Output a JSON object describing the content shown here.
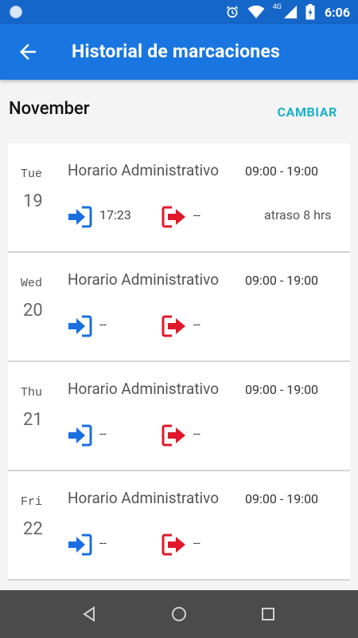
{
  "status_bar": {
    "time": "6:06",
    "network": "4G"
  },
  "app_bar": {
    "title": "Historial de marcaciones",
    "back_icon": "arrow-back-icon"
  },
  "month": {
    "title": "November",
    "change_label": "CAMBIAR"
  },
  "colors": {
    "primary": "#1976e0",
    "status": "#1566c9",
    "accent": "#1ab1c9",
    "in": "#1a6fe0",
    "out": "#e0182a"
  },
  "days": [
    {
      "day_name": "Tue",
      "day_num": "19",
      "schedule": "Horario Administrativo",
      "hours": "09:00 - 19:00",
      "in_time": "17:23",
      "out_time": "--",
      "note": "atraso 8 hrs"
    },
    {
      "day_name": "Wed",
      "day_num": "20",
      "schedule": "Horario Administrativo",
      "hours": "09:00 - 19:00",
      "in_time": "--",
      "out_time": "--",
      "note": ""
    },
    {
      "day_name": "Thu",
      "day_num": "21",
      "schedule": "Horario Administrativo",
      "hours": "09:00 - 19:00",
      "in_time": "--",
      "out_time": "--",
      "note": ""
    },
    {
      "day_name": "Fri",
      "day_num": "22",
      "schedule": "Horario Administrativo",
      "hours": "09:00 - 19:00",
      "in_time": "--",
      "out_time": "--",
      "note": ""
    }
  ]
}
